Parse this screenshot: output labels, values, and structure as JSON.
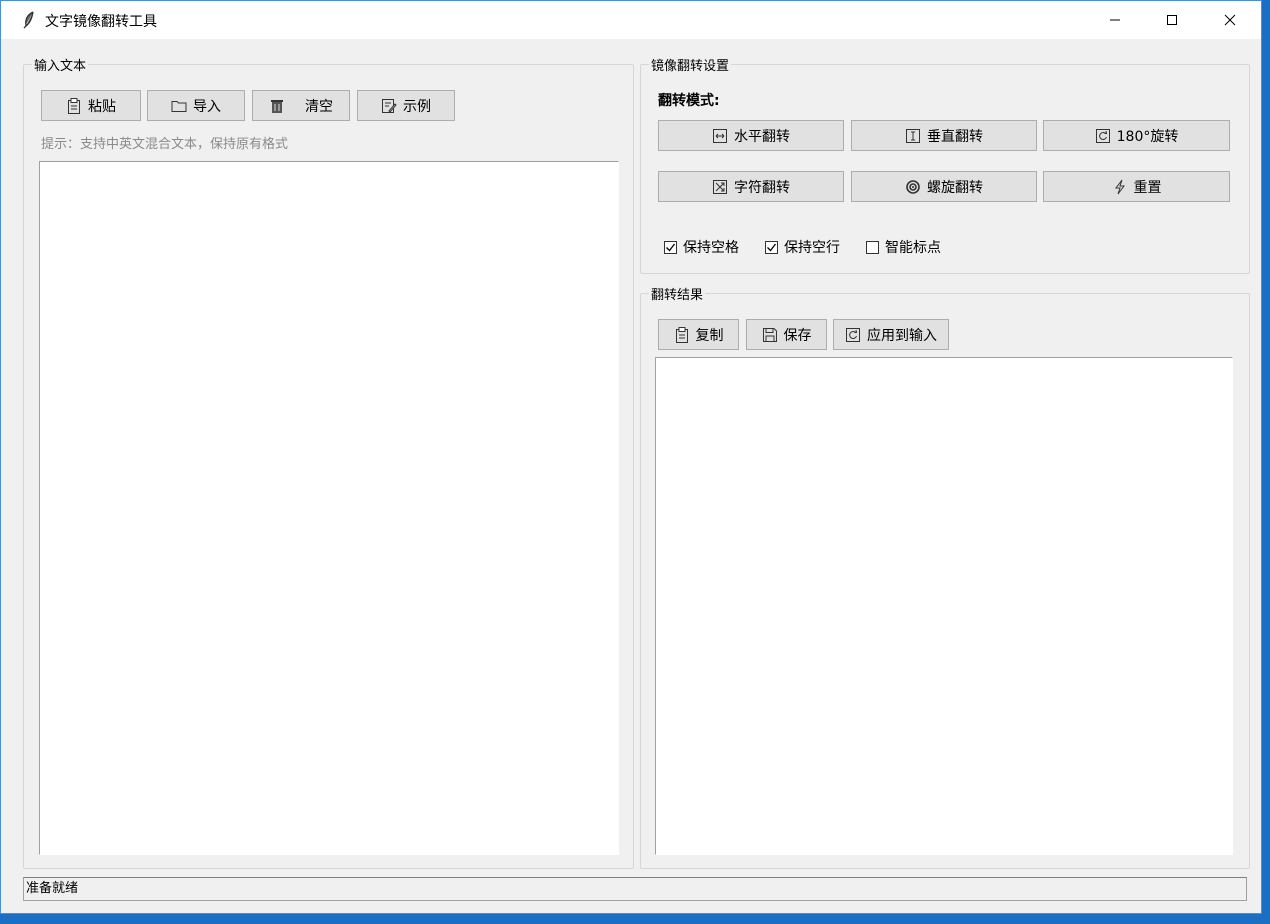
{
  "window": {
    "title": "文字镜像翻转工具",
    "icon": "feather-icon",
    "controls": [
      "minimize-icon",
      "maximize-icon",
      "close-icon"
    ]
  },
  "input": {
    "legend": "输入文本",
    "buttons": {
      "paste": {
        "label": "粘贴",
        "icon": "clipboard-icon"
      },
      "import": {
        "label": "导入",
        "icon": "folder-icon"
      },
      "clear": {
        "label": "清空",
        "icon": "trash-icon"
      },
      "example": {
        "label": "示例",
        "icon": "note-icon"
      }
    },
    "hint": "提示：支持中英文混合文本，保持原有格式",
    "text": ""
  },
  "settings": {
    "legend": "镜像翻转设置",
    "mode_label": "翻转模式:",
    "modes": {
      "horizontal": {
        "label": "水平翻转",
        "icon": "horizontal-arrows-icon"
      },
      "vertical": {
        "label": "垂直翻转",
        "icon": "vertical-bar-icon"
      },
      "rotate180": {
        "label": "180°旋转",
        "icon": "rotate-icon"
      },
      "char": {
        "label": "字符翻转",
        "icon": "shuffle-icon"
      },
      "spiral": {
        "label": "螺旋翻转",
        "icon": "spiral-icon"
      },
      "reset": {
        "label": "重置",
        "icon": "lightning-icon"
      }
    },
    "options": {
      "keep_spaces": {
        "label": "保持空格",
        "checked": true
      },
      "keep_blank_lines": {
        "label": "保持空行",
        "checked": true
      },
      "smart_punct": {
        "label": "智能标点",
        "checked": false
      }
    }
  },
  "result": {
    "legend": "翻转结果",
    "buttons": {
      "copy": {
        "label": "复制",
        "icon": "clipboard-icon"
      },
      "save": {
        "label": "保存",
        "icon": "floppy-icon"
      },
      "apply": {
        "label": "应用到输入",
        "icon": "refresh-icon"
      }
    },
    "text": ""
  },
  "status": "准备就绪",
  "colors": {
    "window_bg": "#f0f0f0",
    "button_bg": "#e1e1e1",
    "button_border": "#adadad",
    "hint": "#8a8a8a",
    "desktop": "#1a6fc4"
  }
}
